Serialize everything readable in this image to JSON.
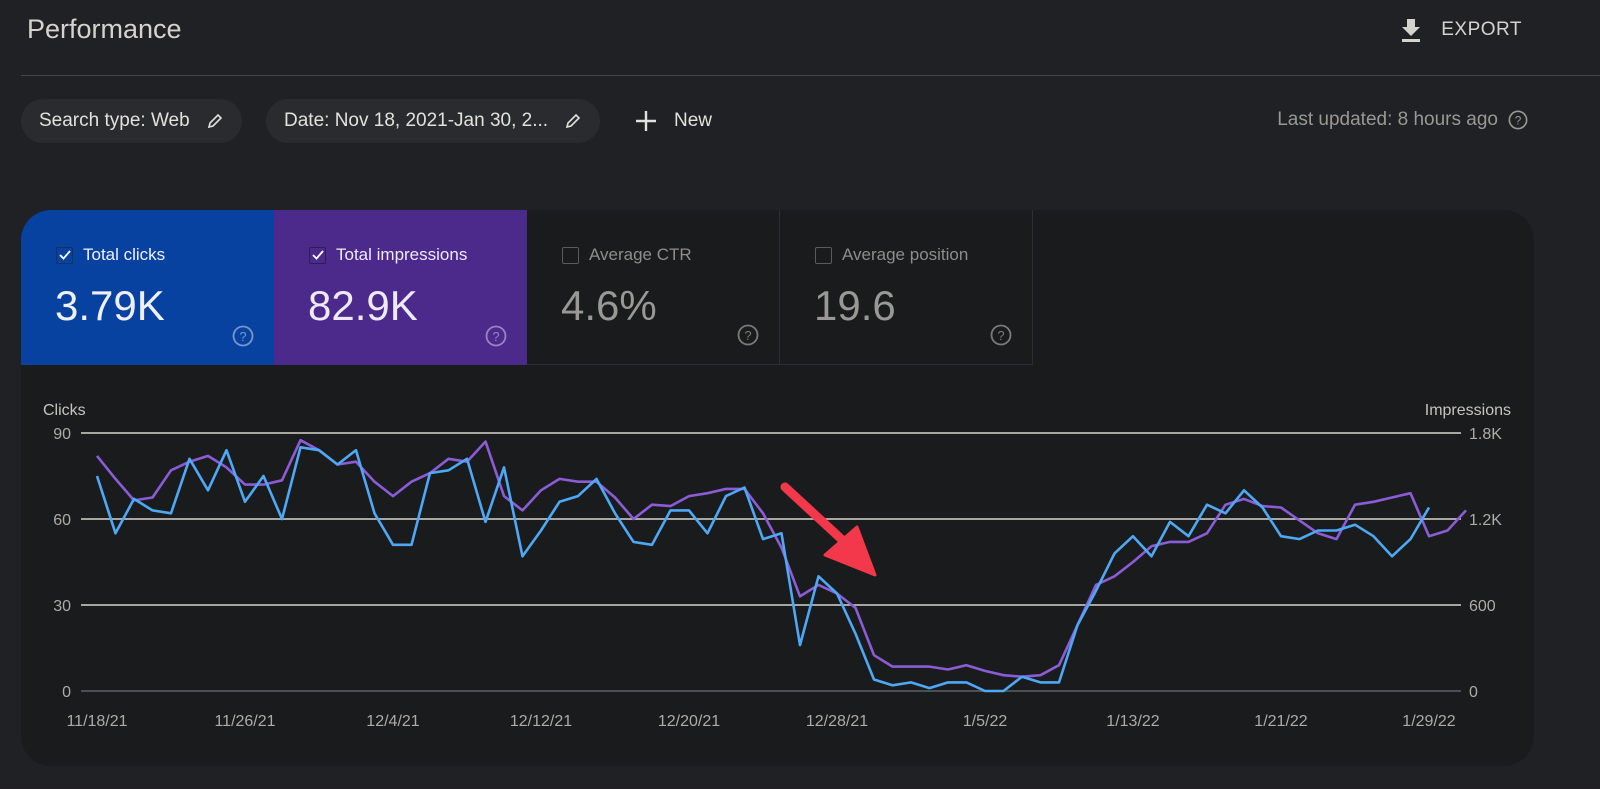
{
  "header": {
    "title": "Performance",
    "export_label": "EXPORT"
  },
  "filters": {
    "search_type": "Search type: Web",
    "date": "Date: Nov 18, 2021-Jan 30, 2...",
    "new_label": "New",
    "last_updated": "Last updated: 8 hours ago"
  },
  "metrics": [
    {
      "label": "Total clicks",
      "value": "3.79K",
      "checked": true,
      "color": "#0842a0"
    },
    {
      "label": "Total impressions",
      "value": "82.9K",
      "checked": true,
      "color": "#4b2a8c"
    },
    {
      "label": "Average CTR",
      "value": "4.6%",
      "checked": false
    },
    {
      "label": "Average position",
      "value": "19.6",
      "checked": false
    }
  ],
  "chart_data": {
    "type": "line",
    "title": "",
    "y_left_label": "Clicks",
    "y_right_label": "Impressions",
    "y_left_ticks": [
      "0",
      "30",
      "60",
      "90"
    ],
    "y_right_ticks": [
      "0",
      "600",
      "1.2K",
      "1.8K"
    ],
    "y_left_range": [
      0,
      90
    ],
    "y_right_range": [
      0,
      1800
    ],
    "x_tick_labels": [
      "11/18/21",
      "11/26/21",
      "12/4/21",
      "12/12/21",
      "12/20/21",
      "12/28/21",
      "1/5/22",
      "1/13/22",
      "1/21/22",
      "1/29/22"
    ],
    "x_start": "11/18/21",
    "x_end": "1/30/22",
    "grid": true,
    "series": [
      {
        "name": "Clicks",
        "axis": "left",
        "color": "#4ea8f5",
        "values": [
          75,
          55,
          67,
          63,
          62,
          81,
          70,
          84,
          66,
          75,
          60,
          85,
          84,
          79,
          84,
          62,
          51,
          51,
          76,
          77,
          81,
          59,
          78,
          47,
          56,
          66,
          68,
          74,
          62,
          52,
          51,
          63,
          63,
          55,
          68,
          71,
          53,
          55,
          16,
          40,
          34,
          20,
          4,
          2,
          3,
          1,
          3,
          3,
          0,
          0,
          5,
          3,
          3,
          23,
          35,
          48,
          54,
          47,
          59,
          54,
          65,
          62,
          70,
          64,
          54,
          53,
          56,
          56,
          58,
          54,
          47,
          53,
          64
        ]
      },
      {
        "name": "Impressions",
        "axis": "right",
        "color": "#8b5cd6",
        "values": [
          1640,
          1480,
          1330,
          1350,
          1540,
          1600,
          1640,
          1560,
          1440,
          1440,
          1470,
          1750,
          1680,
          1580,
          1600,
          1460,
          1360,
          1460,
          1520,
          1620,
          1600,
          1740,
          1360,
          1260,
          1400,
          1480,
          1460,
          1460,
          1350,
          1200,
          1300,
          1290,
          1360,
          1380,
          1410,
          1410,
          1240,
          1000,
          660,
          740,
          680,
          580,
          250,
          170,
          170,
          170,
          150,
          180,
          140,
          110,
          100,
          110,
          180,
          460,
          740,
          800,
          900,
          1010,
          1040,
          1040,
          1100,
          1300,
          1340,
          1290,
          1280,
          1190,
          1100,
          1060,
          1300,
          1320,
          1350,
          1380,
          1080,
          1120,
          1260
        ]
      }
    ],
    "annotations": [
      {
        "type": "arrow",
        "color": "#f2384a",
        "target": "12/31/21"
      }
    ]
  }
}
